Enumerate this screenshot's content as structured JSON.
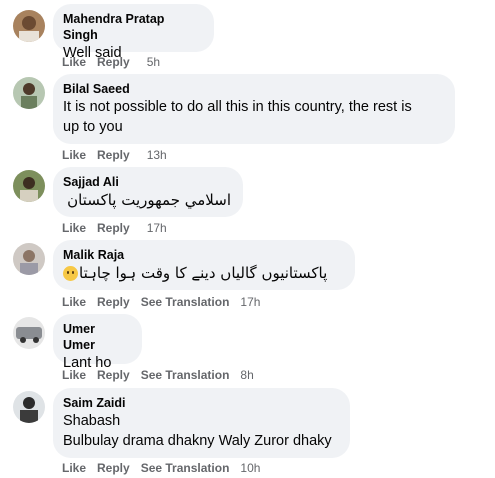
{
  "comments": [
    {
      "author": "Mahendra Pratap Singh",
      "text": "Well said",
      "like": "Like",
      "reply": "Reply",
      "time": "5h"
    },
    {
      "author": "Bilal Saeed",
      "text_line1": "It is not possible to do all this in this country, the rest is",
      "text_line2": "up to you",
      "like": "Like",
      "reply": "Reply",
      "time": "13h"
    },
    {
      "author": "Sajjad Ali",
      "text": "اسلامي جمهوريت پاکستان",
      "like": "Like",
      "reply": "Reply",
      "time": "17h"
    },
    {
      "author": "Malik Raja",
      "text": "پاکستانیوں گالیاں دینے کا وقت ہوا چاہتا",
      "emoji": "slightly-smiling-face",
      "like": "Like",
      "reply": "Reply",
      "translate": "See Translation",
      "time": "17h"
    },
    {
      "author": "Umer Umer",
      "text": "Lant ho",
      "like": "Like",
      "reply": "Reply",
      "translate": "See Translation",
      "time": "8h"
    },
    {
      "author": "Saim Zaidi",
      "text_line1": "Shabash",
      "text_line2": "Bulbulay drama dhakny Waly Zuror dhaky",
      "like": "Like",
      "reply": "Reply",
      "translate": "See Translation",
      "time": "10h"
    }
  ],
  "colors": {
    "bubble": "#f0f2f5",
    "meta": "#65676b",
    "text": "#050505"
  }
}
